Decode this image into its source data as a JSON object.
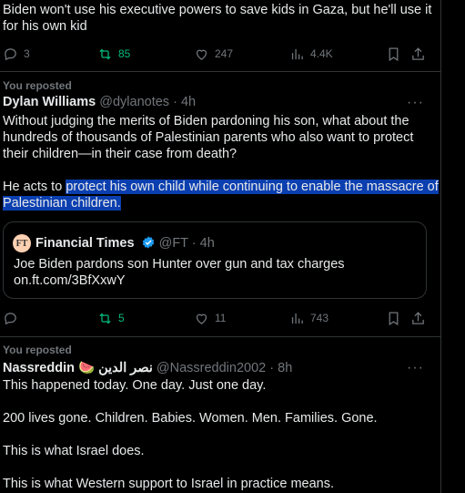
{
  "post1": {
    "text_lines": [
      "Biden won't use his executive powers to save kids in Gaza, but he'll use it",
      "for his own kid"
    ],
    "replies": "3",
    "reposts": "85",
    "likes": "247",
    "views": "4.4K"
  },
  "post2": {
    "reposted_label": "You reposted",
    "author_name": "Dylan Williams",
    "handle": "@dylanotes",
    "separator": "·",
    "time": "4h",
    "more": "···",
    "text_lines": [
      "Without judging the merits of Biden pardoning his son, what about the",
      "hundreds of thousands of Palestinian parents who also want to protect",
      "their children—in their case from death?"
    ],
    "text2_prefix": "He acts to ",
    "text2_highlight_line1": "protect his own child while continuing to enable the massacre of",
    "text2_highlight_line2": "Palestinian children.",
    "quote": {
      "logo": "FT",
      "author_name": "Financial Times",
      "handle": "@FT",
      "separator": "·",
      "time": "4h",
      "text": "Joe Biden pardons son Hunter over gun and tax charges",
      "link": "on.ft.com/3BfXxwY"
    },
    "replies": "",
    "reposts": "5",
    "likes": "11",
    "views": "743"
  },
  "post3": {
    "reposted_label": "You reposted",
    "author_name": "Nassreddin 🍉 نصر الدين",
    "handle": "@Nassreddin2002",
    "separator": "·",
    "time": "8h",
    "more": "···",
    "paragraphs": [
      "This happened today. One day. Just one day.",
      "200 lives gone. Children. Babies. Women. Men. Families. Gone.",
      "This is what Israel does.",
      "This is what Western support to Israel in practice means."
    ]
  },
  "colors": {
    "background": "#000000",
    "text": "#e7e9ea",
    "muted": "#71767b",
    "repost_green": "#00ba7c",
    "selection": "#0b3fb0",
    "verified_blue": "#1d9bf0"
  },
  "icons": [
    "reply-icon",
    "repost-icon",
    "like-icon",
    "views-icon",
    "bookmark-icon",
    "share-icon",
    "verified-icon"
  ]
}
